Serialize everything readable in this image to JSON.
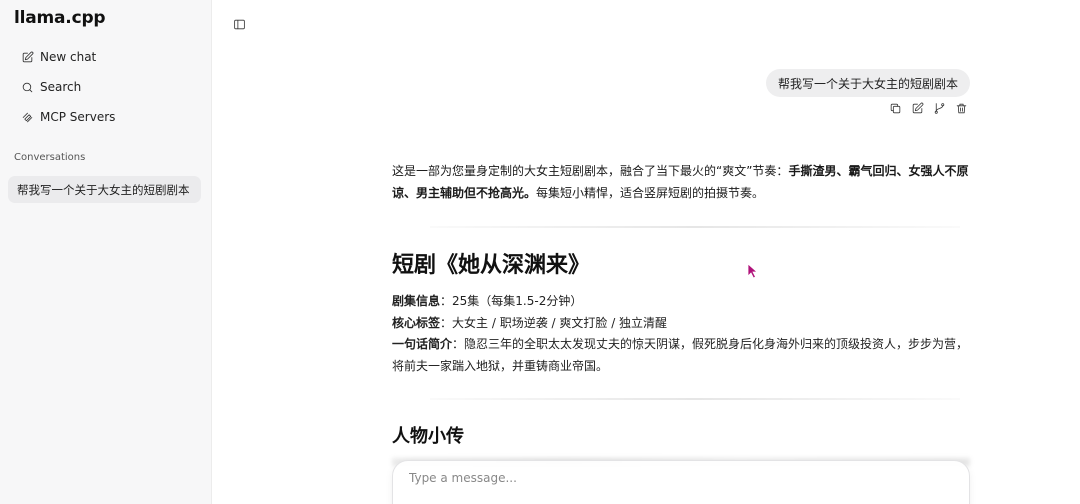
{
  "app": {
    "title": "llama.cpp"
  },
  "sidebar": {
    "items": [
      {
        "label": "New chat",
        "icon": "edit-icon"
      },
      {
        "label": "Search",
        "icon": "search-icon"
      },
      {
        "label": "MCP Servers",
        "icon": "mcp-icon"
      }
    ],
    "conversations_heading": "Conversations",
    "conversations": [
      {
        "title": "帮我写一个关于大女主的短剧剧本"
      }
    ]
  },
  "chat": {
    "user_message": "帮我写一个关于大女主的短剧剧本",
    "actions": [
      "copy-icon",
      "edit-icon",
      "branch-icon",
      "delete-icon"
    ],
    "assistant": {
      "intro_plain_1": "这是一部为您量身定制的大女主短剧剧本，融合了当下最火的“爽文”节奏：",
      "intro_bold": "手撕渣男、霸气回归、女强人不原谅、男主辅助但不抢高光。",
      "intro_plain_2": "每集短小精悍，适合竖屏短剧的拍摄节奏。",
      "heading": "短剧《她从深渊来》",
      "meta": [
        {
          "label": "剧集信息",
          "sep": "：",
          "value": "25集（每集1.5-2分钟）"
        },
        {
          "label": "核心标签",
          "sep": "：",
          "value": "大女主 / 职场逆袭 / 爽文打脸 / 独立清醒"
        },
        {
          "label": "一句话简介",
          "sep": "：",
          "value": "隐忍三年的全职太太发现丈夫的惊天阴谋，假死脱身后化身海外归来的顶级投资人，步步为营，将前夫一家踹入地狱，并重铸商业帝国。"
        }
      ],
      "section_heading": "人物小传"
    }
  },
  "input": {
    "placeholder": "Type a message...",
    "value": ""
  }
}
